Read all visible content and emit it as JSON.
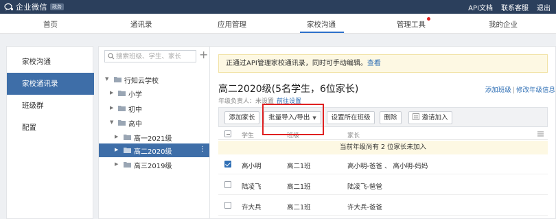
{
  "topbar": {
    "logo_text": "企业微信",
    "logo_badge": "政务",
    "links": [
      "API文档",
      "联系客服",
      "退出"
    ]
  },
  "nav": {
    "items": [
      "首页",
      "通讯录",
      "应用管理",
      "家校沟通",
      "管理工具",
      "我的企业"
    ],
    "active": "家校沟通"
  },
  "sidebar": {
    "items": [
      "家校沟通",
      "家校通讯录",
      "班级群",
      "配置"
    ],
    "active": "家校通讯录"
  },
  "tree": {
    "search_placeholder": "搜索班级、学生、家长",
    "add_symbol": "+",
    "nodes": [
      {
        "label": "行知云学校",
        "state": "expanded"
      },
      {
        "label": "小学",
        "state": "collapsed"
      },
      {
        "label": "初中",
        "state": "collapsed"
      },
      {
        "label": "高中",
        "state": "expanded"
      },
      {
        "label": "高一2021级",
        "state": "collapsed"
      },
      {
        "label": "高二2020级",
        "state": "collapsed",
        "selected": true
      },
      {
        "label": "高三2019级",
        "state": "collapsed"
      }
    ],
    "more_symbol": "⋮"
  },
  "content": {
    "notice_text": "正通过API管理家校通讯录，同时可手动编辑。",
    "notice_link": "查看",
    "title": "高二2020级(5名学生，6位家长)",
    "actions": {
      "add_class": "添加班级",
      "separator": "|",
      "edit_grade": "修改年级信息"
    },
    "owner_label": "年级负责人：未设置",
    "owner_link": "前往设置",
    "toolbar": {
      "add_parent": "添加家长",
      "batch": "批量导入/导出",
      "batch_arrow": "▼",
      "set_class": "设置所在班级",
      "delete": "删除",
      "invite": "邀请加入"
    },
    "columns": [
      "学生",
      "班级",
      "家长"
    ],
    "pending_text": "当前年级尚有 2 位家长未加入",
    "rows": [
      {
        "student": "高小明",
        "class": "高二1班",
        "parents": "高小明-爸爸 、 高小明-妈妈",
        "checked": true
      },
      {
        "student": "陆凌飞",
        "class": "高二1班",
        "parents": "陆凌飞-爸爸",
        "checked": false
      },
      {
        "student": "许大兵",
        "class": "高二1班",
        "parents": "许大兵-爸爸",
        "checked": false
      }
    ]
  },
  "colors": {
    "topbar": "#2b3f5c",
    "accent": "#3e6ea8",
    "link": "#2f6fb5",
    "highlight_border": "#e02020",
    "notice_bg": "#fdf8e3"
  }
}
